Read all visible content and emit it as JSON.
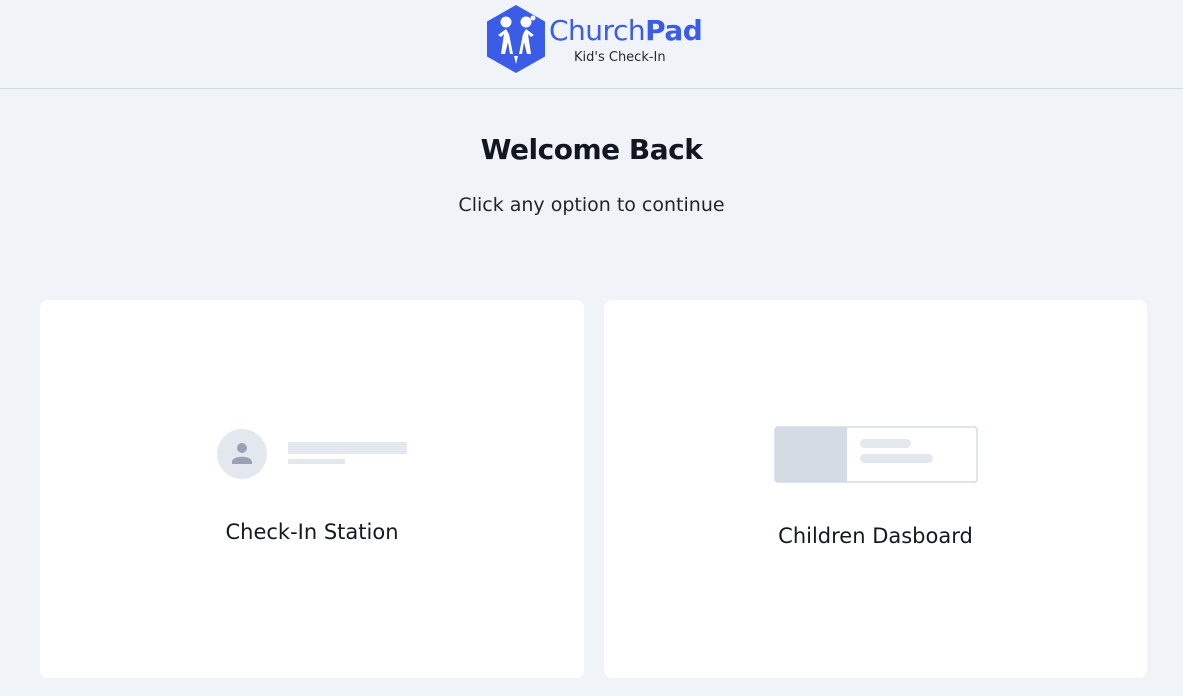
{
  "header": {
    "logo": {
      "name_light": "Church",
      "name_bold": "Pad",
      "subtitle": "Kid's Check-In",
      "brand_color": "#3b5ce6"
    }
  },
  "welcome": {
    "title": "Welcome Back",
    "subtitle": "Click any option to continue"
  },
  "options": [
    {
      "label": "Check-In Station",
      "icon": "user-card-illustration"
    },
    {
      "label": "Children Dasboard",
      "icon": "dashboard-panel-illustration"
    }
  ],
  "colors": {
    "background": "#f0f3f8",
    "card": "#ffffff",
    "placeholder": "#e3e8ef",
    "placeholder_dark": "#d4dbe5",
    "icon_gray": "#98a2b3"
  }
}
